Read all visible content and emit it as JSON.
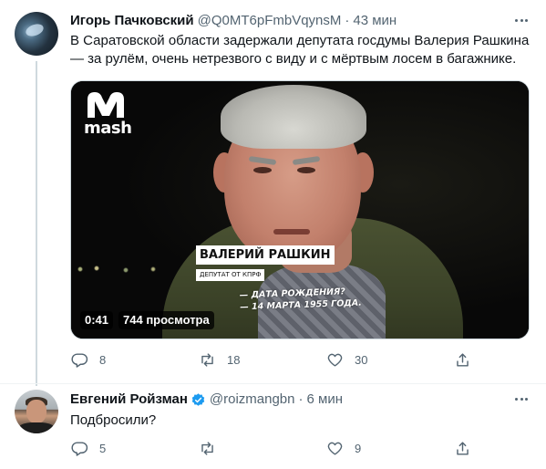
{
  "tweets": [
    {
      "author_name": "Игорь Пачковский",
      "handle": "@Q0MT6pFmbVqynsM",
      "separator": "·",
      "time": "43 мин",
      "text": "В Саратовской области задержали депутата госдумы Валерия Рашкина — за рулём, очень нетрезвого с виду и с мёртвым лосем в багажнике.",
      "media": {
        "logo_text": "mash",
        "lower_third_name": "ВАЛЕРИЙ РАШКИН",
        "lower_third_title": "ДЕПУТАТ ОТ КПРФ",
        "caption_line1": "— ДАТА РОЖДЕНИЯ?",
        "caption_line2": "— 14 МАРТА 1955 ГОДА.",
        "duration": "0:41",
        "views": "744 просмотра"
      },
      "actions": {
        "reply_count": "8",
        "retweet_count": "18",
        "like_count": "30"
      }
    },
    {
      "author_name": "Евгений Ройзман",
      "handle": "@roizmangbn",
      "separator": "·",
      "time": "6 мин",
      "text": "Подбросили?",
      "actions": {
        "reply_count": "5",
        "retweet_count": "",
        "like_count": "9"
      }
    }
  ],
  "colors": {
    "text_primary": "#0f1419",
    "text_secondary": "#536471",
    "verified_blue": "#1d9bf0",
    "thread_line": "#cfd9de"
  },
  "icons": [
    "more-icon",
    "reply-icon",
    "retweet-icon",
    "like-icon",
    "share-icon",
    "verified-badge-icon",
    "mash-logo-icon"
  ]
}
